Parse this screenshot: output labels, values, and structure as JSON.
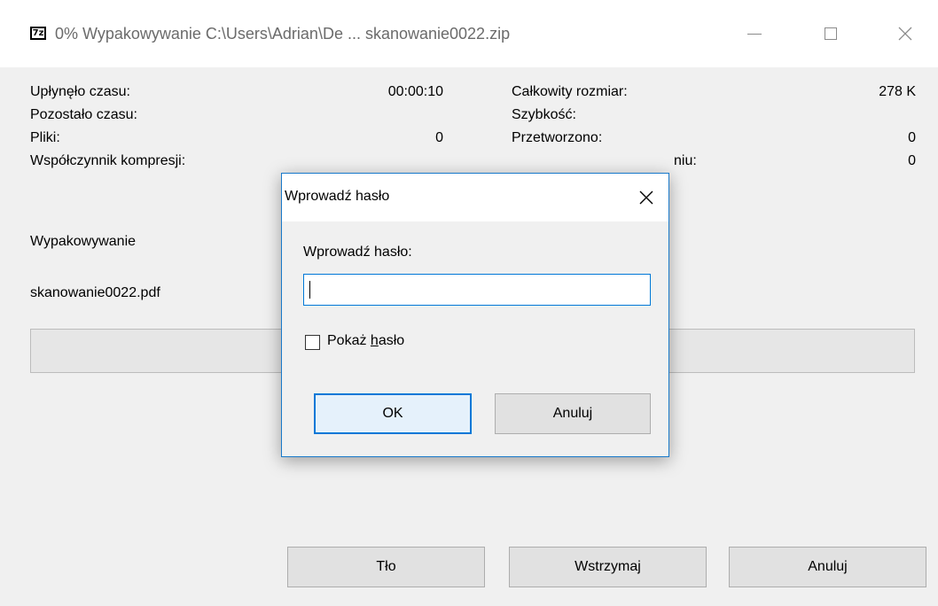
{
  "window": {
    "app_icon_text": "7z",
    "title": "0% Wypakowywanie C:\\Users\\Adrian\\De ... skanowanie0022.zip"
  },
  "stats": {
    "elapsed_label": "Upłynęło czasu:",
    "elapsed_value": "00:00:10",
    "remaining_label": "Pozostało czasu:",
    "files_label": "Pliki:",
    "files_value": "0",
    "ratio_label": "Współczynnik kompresji:",
    "total_size_label": "Całkowity rozmiar:",
    "total_size_value": "278 K",
    "speed_label": "Szybkość:",
    "processed_label": "Przetworzono:",
    "processed_value": "0",
    "partial_label_visible": "niu:",
    "partial_value": "0"
  },
  "operation": {
    "status": "Wypakowywanie",
    "current_file": "skanowanie0022.pdf",
    "progress": 0
  },
  "buttons": {
    "background": "Tło",
    "pause": "Wstrzymaj",
    "cancel": "Anuluj"
  },
  "dialog": {
    "title": "Wprowadź hasło",
    "prompt": "Wprowadź hasło:",
    "password_value": "",
    "show_password_prefix": "Pokaż ",
    "show_password_accel": "h",
    "show_password_suffix": "asło",
    "show_password_checked": false,
    "ok": "OK",
    "cancel": "Anuluj"
  },
  "colors": {
    "accent": "#0078d7",
    "window_bg": "#f0f0f0",
    "titlebar_bg": "#ffffff"
  }
}
